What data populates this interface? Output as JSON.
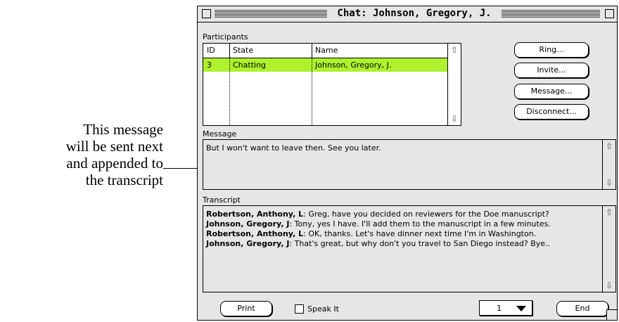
{
  "annotation": {
    "line1": "This message",
    "line2": "will be sent next",
    "line3": "and appended to",
    "line4": "the transcript"
  },
  "window": {
    "title": "Chat: Johnson, Gregory, J."
  },
  "participants": {
    "label": "Participants",
    "columns": [
      "ID",
      "State",
      "Name"
    ],
    "rows": [
      {
        "id": "3",
        "state": "Chatting",
        "name": "Johnson, Gregory, J.",
        "selected": true
      }
    ],
    "highlight_color": "#aef12c"
  },
  "buttons": {
    "ring": "Ring...",
    "invite": "Invite...",
    "message": "Message...",
    "disconnect": "Disconnect..."
  },
  "message": {
    "label": "Message",
    "text": "But I won't want to leave then. See you later."
  },
  "transcript": {
    "label": "Transcript",
    "lines": [
      {
        "speaker": "Robertson, Anthony, L",
        "text": ":  Greg, have you decided on reviewers for the Doe manuscript?"
      },
      {
        "speaker": "Johnson, Gregory, J",
        "text": ":  Tony, yes I have.  I'll add them to the manuscript in a few minutes."
      },
      {
        "speaker": "Robertson, Anthony, L",
        "text": ":  OK, thanks.  Let's have dinner next time I'm in Washington."
      },
      {
        "speaker": "Johnson, Gregory, J",
        "text": ":  That's great, but why don't you travel to San Diego instead?  Bye.."
      }
    ]
  },
  "footer": {
    "print": "Print",
    "speak_label": "Speak It",
    "speak_checked": false,
    "popup_value": "1",
    "end": "End"
  },
  "icons": [
    "close-box-icon",
    "zoom-box-icon",
    "scroll-up-arrow-icon",
    "scroll-down-arrow-icon",
    "popup-triangle-icon",
    "grow-box-icon"
  ]
}
